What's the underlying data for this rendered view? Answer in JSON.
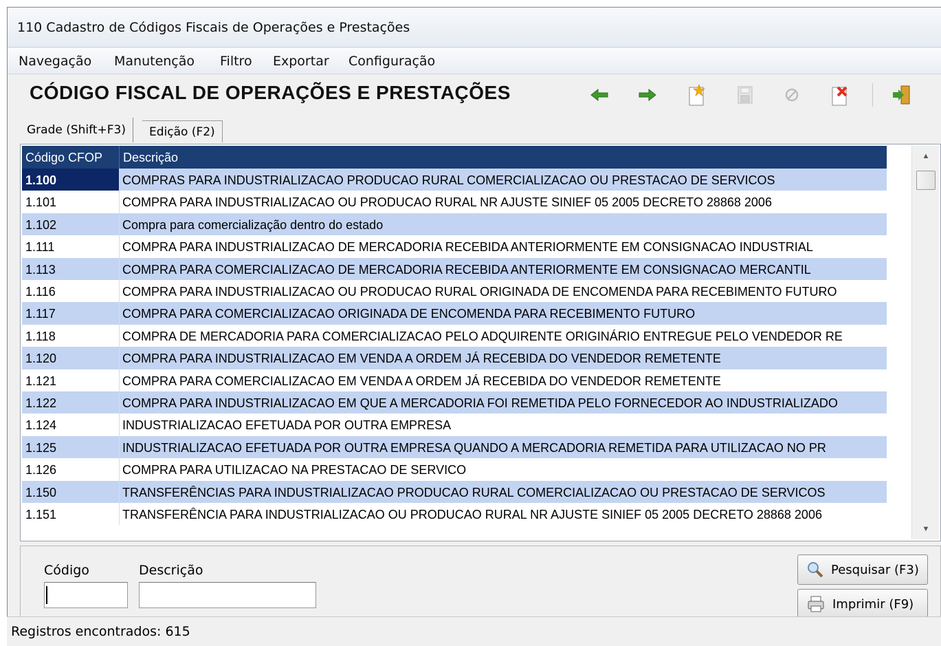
{
  "window": {
    "title": "110 Cadastro de Códigos Fiscais de Operações e Prestações"
  },
  "menu": [
    "Navegação",
    "Manutenção",
    "Filtro",
    "Exportar",
    "Configuração"
  ],
  "header": {
    "title": "CÓDIGO FISCAL DE OPERAÇÕES E PRESTAÇÕES"
  },
  "toolbar": {
    "icons": [
      "arrow-left-icon",
      "arrow-right-icon",
      "new-document-icon",
      "save-icon",
      "cancel-icon",
      "delete-icon",
      "exit-icon"
    ]
  },
  "tabs": [
    {
      "label": "Grade (Shift+F3)",
      "active": true
    },
    {
      "label": "Edição (F2)",
      "active": false
    }
  ],
  "grid": {
    "columns": [
      "Código CFOP",
      "Descrição"
    ],
    "rows": [
      {
        "code": "1.100",
        "desc": "COMPRAS PARA INDUSTRIALIZACAO PRODUCAO RURAL COMERCIALIZACAO OU PRESTACAO DE SERVICOS"
      },
      {
        "code": "1.101",
        "desc": "COMPRA PARA INDUSTRIALIZACAO OU PRODUCAO RURAL NR AJUSTE SINIEF 05 2005 DECRETO 28868 2006"
      },
      {
        "code": "1.102",
        "desc": "Compra para comercialização dentro do estado"
      },
      {
        "code": "1.111",
        "desc": "COMPRA PARA INDUSTRIALIZACAO DE MERCADORIA RECEBIDA ANTERIORMENTE EM CONSIGNACAO INDUSTRIAL"
      },
      {
        "code": "1.113",
        "desc": "COMPRA PARA COMERCIALIZACAO DE MERCADORIA RECEBIDA ANTERIORMENTE EM CONSIGNACAO MERCANTIL"
      },
      {
        "code": "1.116",
        "desc": "COMPRA PARA INDUSTRIALIZACAO OU PRODUCAO RURAL ORIGINADA DE ENCOMENDA PARA RECEBIMENTO FUTURO"
      },
      {
        "code": "1.117",
        "desc": "COMPRA PARA COMERCIALIZACAO ORIGINADA DE ENCOMENDA PARA RECEBIMENTO FUTURO"
      },
      {
        "code": "1.118",
        "desc": "COMPRA DE MERCADORIA PARA COMERCIALIZACAO PELO ADQUIRENTE ORIGINÁRIO ENTREGUE PELO VENDEDOR RE"
      },
      {
        "code": "1.120",
        "desc": "COMPRA PARA INDUSTRIALIZACAO EM VENDA A ORDEM JÁ RECEBIDA DO VENDEDOR REMETENTE"
      },
      {
        "code": "1.121",
        "desc": "COMPRA PARA COMERCIALIZACAO EM VENDA A ORDEM JÁ RECEBIDA DO VENDEDOR REMETENTE"
      },
      {
        "code": "1.122",
        "desc": "COMPRA PARA INDUSTRIALIZACAO EM QUE A MERCADORIA FOI REMETIDA PELO FORNECEDOR AO INDUSTRIALIZADO"
      },
      {
        "code": "1.124",
        "desc": "INDUSTRIALIZACAO EFETUADA POR OUTRA EMPRESA"
      },
      {
        "code": "1.125",
        "desc": "INDUSTRIALIZACAO EFETUADA POR OUTRA EMPRESA QUANDO A MERCADORIA REMETIDA PARA UTILIZACAO NO PR"
      },
      {
        "code": "1.126",
        "desc": "COMPRA PARA UTILIZACAO NA PRESTACAO DE SERVICO"
      },
      {
        "code": "1.150",
        "desc": "TRANSFERÊNCIAS PARA INDUSTRIALIZACAO PRODUCAO RURAL COMERCIALIZACAO OU PRESTACAO DE SERVICOS"
      },
      {
        "code": "1.151",
        "desc": "TRANSFERÊNCIA PARA INDUSTRIALIZACAO OU PRODUCAO RURAL NR AJUSTE SINIEF 05 2005 DECRETO 28868 2006"
      }
    ]
  },
  "filter": {
    "code_label": "Código",
    "desc_label": "Descrição",
    "code_value": "",
    "desc_value": ""
  },
  "buttons": {
    "search": "Pesquisar (F3)",
    "print": "Imprimir (F9)"
  },
  "status": {
    "text": "Registros encontrados: 615"
  },
  "colors": {
    "header_bg": "#1b3e74",
    "row_alt": "#c3d4f2",
    "selected": "#0c2666"
  }
}
